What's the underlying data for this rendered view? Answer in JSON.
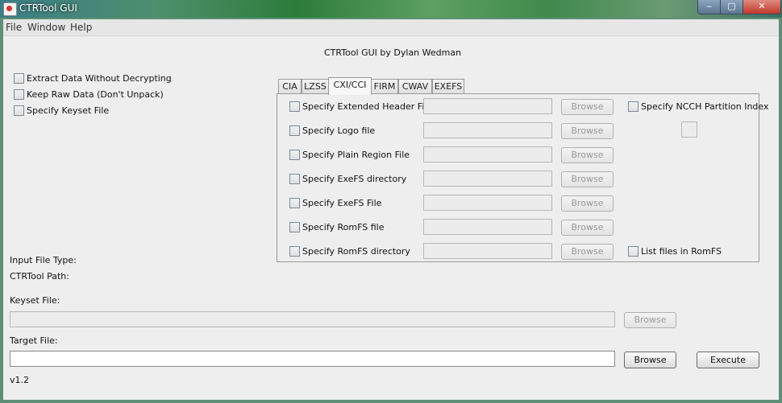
{
  "window": {
    "title": "CTRTool GUI",
    "minimize": "‒",
    "maximize": "▢",
    "close": "✕"
  },
  "menu": {
    "items": [
      "File",
      "Window",
      "Help"
    ]
  },
  "header": {
    "caption": "CTRTool GUI by Dylan Wedman"
  },
  "options": {
    "extract_without_decrypting": "Extract Data Without Decrypting",
    "keep_raw_data": "Keep Raw Data (Don't Unpack)",
    "specify_keyset": "Specify Keyset File"
  },
  "tabs": [
    "CIA",
    "LZSS",
    "CXI/CCI",
    "FIRM",
    "CWAV",
    "EXEFS"
  ],
  "active_tab": "CXI/CCI",
  "cxi": {
    "rows": [
      "Specify Extended Header File",
      "Specify Logo file",
      "Specify Plain Region File",
      "Specify ExeFS directory",
      "Specify ExeFS File",
      "Specify RomFS file",
      "Specify RomFS directory"
    ],
    "browse_label": "Browse",
    "ncch_partition": "Specify NCCH Partition Index",
    "list_romfs": "List files in RomFS"
  },
  "info": {
    "input_file_type": "Input File Type:",
    "ctrtool_path": "CTRTool Path:"
  },
  "keyset": {
    "label": "Keyset File:",
    "browse": "Browse"
  },
  "target": {
    "label": "Target File:",
    "browse": "Browse",
    "execute": "Execute"
  },
  "version": "v1.2"
}
